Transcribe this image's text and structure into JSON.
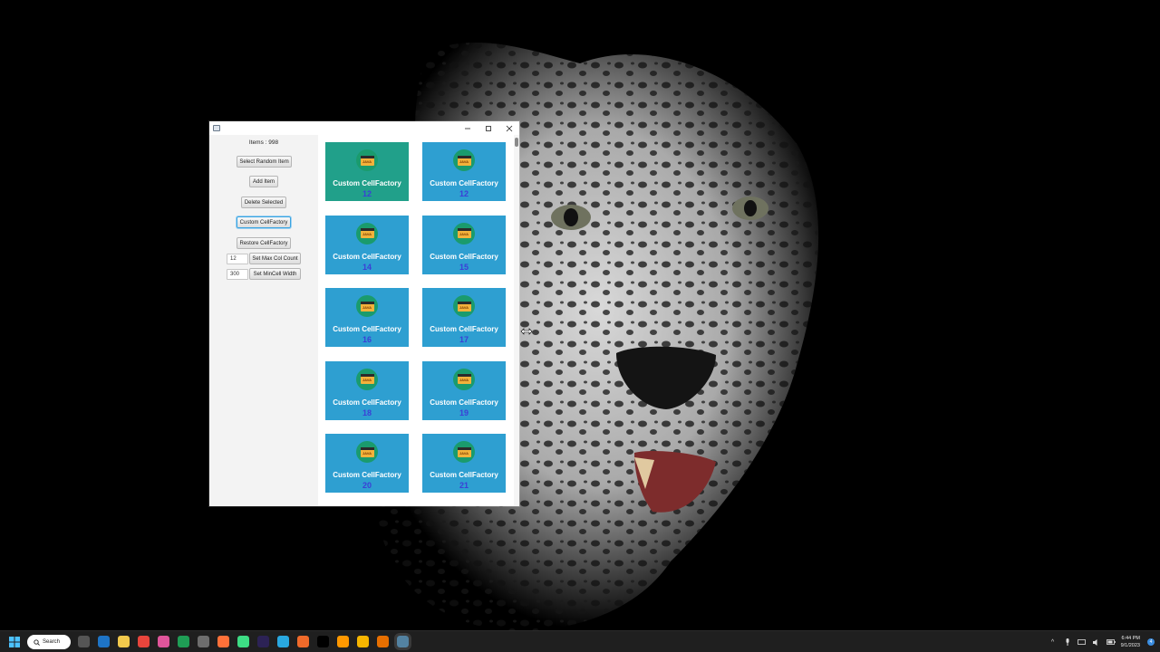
{
  "desktop": {
    "wallpaper": "leopard"
  },
  "window": {
    "items_label": "Items : 998",
    "buttons": {
      "select_random": "Select Random Item",
      "add_item": "Add Item",
      "delete_selected": "Delete Selected",
      "custom_cellfactory": "Custom CellFactory",
      "restore_cellfactory": "Restore CellFactory",
      "set_max_col": "Set Max Col Count",
      "set_min_width": "Set MinCell Width"
    },
    "inputs": {
      "max_col_value": "12",
      "min_width_value": "300"
    },
    "cards": [
      {
        "title": "Custom CellFactory",
        "number": "12",
        "icon_text": "JAVA",
        "selected": true
      },
      {
        "title": "Custom CellFactory",
        "number": "12",
        "icon_text": "JAVA",
        "selected": false
      },
      {
        "title": "Custom CellFactory",
        "number": "14",
        "icon_text": "JAVA",
        "selected": false
      },
      {
        "title": "Custom CellFactory",
        "number": "15",
        "icon_text": "JAVA",
        "selected": false
      },
      {
        "title": "Custom CellFactory",
        "number": "16",
        "icon_text": "JAVA",
        "selected": false
      },
      {
        "title": "Custom CellFactory",
        "number": "17",
        "icon_text": "JAVA",
        "selected": false
      },
      {
        "title": "Custom CellFactory",
        "number": "18",
        "icon_text": "JAVA",
        "selected": false
      },
      {
        "title": "Custom CellFactory",
        "number": "19",
        "icon_text": "JAVA",
        "selected": false
      },
      {
        "title": "Custom CellFactory",
        "number": "20",
        "icon_text": "JAVA",
        "selected": false
      },
      {
        "title": "Custom CellFactory",
        "number": "21",
        "icon_text": "JAVA",
        "selected": false
      }
    ],
    "colors": {
      "card": "#2e9fd1",
      "card_selected": "#21a08a",
      "number": "#3b3fd6"
    }
  },
  "taskbar": {
    "search_label": "Search",
    "time": "6:44 PM",
    "date": "9/1/2023",
    "notification_count": "4",
    "icons": [
      "task-view-icon",
      "outlook-icon",
      "file-explorer-icon",
      "chrome-icon",
      "intellij-icon",
      "excel-icon",
      "app-icon",
      "firefox-icon",
      "android-icon",
      "eclipse-icon",
      "cloud-app-icon",
      "app-icon-2",
      "jetbrains-icon",
      "sublime-icon",
      "sketch-icon",
      "java-icon",
      "java-app-icon"
    ]
  }
}
